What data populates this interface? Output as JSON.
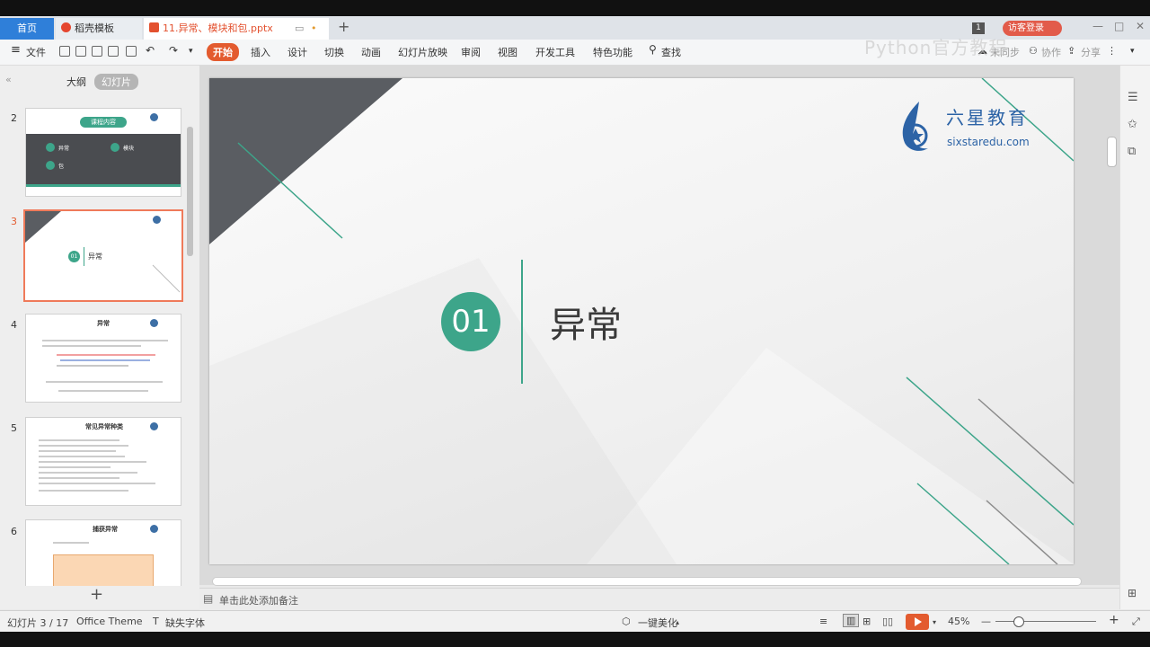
{
  "tabs": {
    "home": "首页",
    "template": "稻壳模板",
    "document": "11.异常、模块和包.pptx"
  },
  "header": {
    "login": "访客登录",
    "watermark": "Python官方教程"
  },
  "menu": {
    "file": "文件",
    "items": [
      "开始",
      "插入",
      "设计",
      "切换",
      "动画",
      "幻灯片放映",
      "审阅",
      "视图",
      "开发工具",
      "特色功能"
    ],
    "search": "查找",
    "sync": "未同步",
    "collab": "协作",
    "share": "分享"
  },
  "panel": {
    "outline": "大纲",
    "slides": "幻灯片"
  },
  "thumbnails": [
    {
      "num": "2",
      "title": "课程内容",
      "items": [
        "异常",
        "模块",
        "包"
      ]
    },
    {
      "num": "3",
      "badge": "01",
      "title": "异常"
    },
    {
      "num": "4",
      "title": "异常"
    },
    {
      "num": "5",
      "title": "常见异常种类"
    },
    {
      "num": "6",
      "title": "捕获异常"
    }
  ],
  "slide": {
    "badge": "01",
    "title": "异常",
    "logo_cn": "六星教育",
    "logo_en": "sixstaredu.com"
  },
  "notes": {
    "placeholder": "单击此处添加备注"
  },
  "status": {
    "slide_count": "幻灯片 3 / 17",
    "theme": "Office Theme",
    "missing_font": "缺失字体",
    "beautify": "一键美化",
    "zoom": "45%"
  },
  "colors": {
    "accent": "#3da58a",
    "tab_active": "#e35b2f",
    "home_tab": "#2f7fd9",
    "dark": "#5a5d62"
  }
}
